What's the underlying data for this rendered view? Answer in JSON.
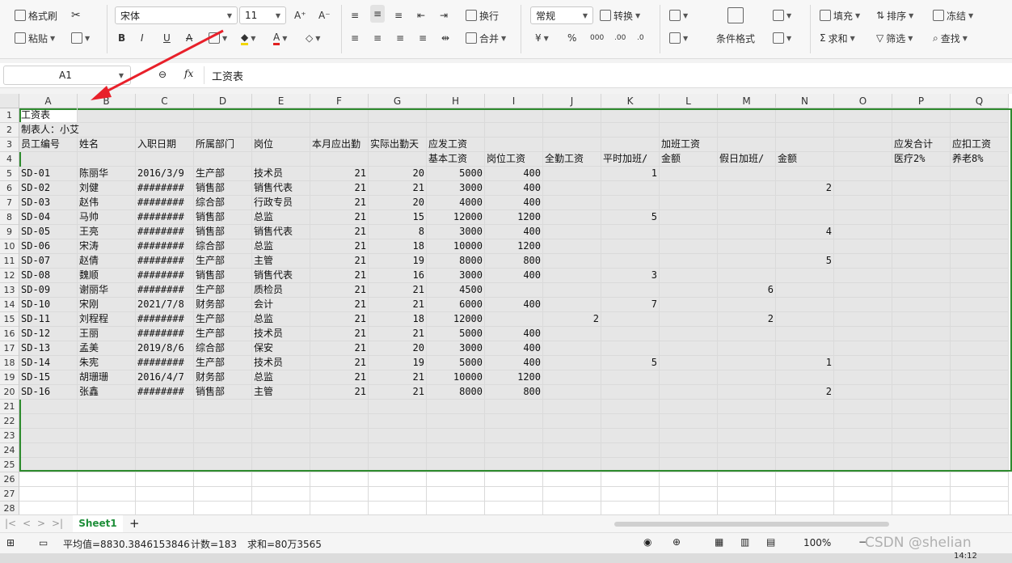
{
  "ribbon": {
    "format_painter": "格式刷",
    "paste": "粘贴",
    "font_name": "宋体",
    "font_size": "11",
    "wrap": "换行",
    "merge": "合并",
    "number_format": "常规",
    "convert": "转换",
    "cond_format": "条件格式",
    "fill": "填充",
    "sort": "排序",
    "freeze": "冻结",
    "sum": "求和",
    "filter": "筛选",
    "find": "查找",
    "bold": "B",
    "italic": "I",
    "underline": "U",
    "font_grow": "A⁺",
    "font_shrink": "A⁻",
    "currency": "¥",
    "percent": "%"
  },
  "formula_bar": {
    "cell_ref": "A1",
    "fx": "fx",
    "content": "工资表"
  },
  "columns": [
    "A",
    "B",
    "C",
    "D",
    "E",
    "F",
    "G",
    "H",
    "I",
    "J",
    "K",
    "L",
    "M",
    "N",
    "O",
    "P",
    "Q"
  ],
  "row_numbers": [
    "1",
    "2",
    "3",
    "4",
    "5",
    "6",
    "7",
    "8",
    "9",
    "10",
    "11",
    "12",
    "13",
    "14",
    "15",
    "16",
    "17",
    "18",
    "19",
    "20",
    "21",
    "22",
    "23",
    "24",
    "25",
    "26",
    "27",
    "28"
  ],
  "rows": [
    [
      "工资表",
      "",
      "",
      "",
      "",
      "",
      "",
      "",
      "",
      "",
      "",
      "",
      "",
      "",
      "",
      "",
      ""
    ],
    [
      "制表人：小艾",
      "",
      "",
      "",
      "",
      "",
      "",
      "",
      "",
      "",
      "",
      "",
      "",
      "",
      "",
      "",
      ""
    ],
    [
      "员工编号",
      "姓名",
      "入职日期",
      "所属部门",
      "岗位",
      "本月应出勤",
      "实际出勤天",
      "应发工资",
      "",
      "",
      "",
      "加班工资",
      "",
      "",
      "",
      "应发合计",
      "应扣工资"
    ],
    [
      "",
      "",
      "",
      "",
      "",
      "",
      "",
      "基本工资",
      "岗位工资",
      "全勤工资",
      "平时加班/",
      "金额",
      "假日加班/",
      "金额",
      "",
      "医疗2%",
      "养老8%"
    ],
    [
      "SD-01",
      "陈丽华",
      "2016/3/9",
      "生产部",
      "技术员",
      "21",
      "20",
      "5000",
      "400",
      "",
      "1",
      "",
      "",
      "",
      "",
      "",
      ""
    ],
    [
      "SD-02",
      "刘健",
      "########",
      "销售部",
      "销售代表",
      "21",
      "21",
      "3000",
      "400",
      "",
      "",
      "",
      "",
      "2",
      "",
      "",
      ""
    ],
    [
      "SD-03",
      "赵伟",
      "########",
      "综合部",
      "行政专员",
      "21",
      "20",
      "4000",
      "400",
      "",
      "",
      "",
      "",
      "",
      "",
      "",
      ""
    ],
    [
      "SD-04",
      "马帅",
      "########",
      "销售部",
      "总监",
      "21",
      "15",
      "12000",
      "1200",
      "",
      "5",
      "",
      "",
      "",
      "",
      "",
      ""
    ],
    [
      "SD-05",
      "王亮",
      "########",
      "销售部",
      "销售代表",
      "21",
      "8",
      "3000",
      "400",
      "",
      "",
      "",
      "",
      "4",
      "",
      "",
      ""
    ],
    [
      "SD-06",
      "宋涛",
      "########",
      "综合部",
      "总监",
      "21",
      "18",
      "10000",
      "1200",
      "",
      "",
      "",
      "",
      "",
      "",
      "",
      ""
    ],
    [
      "SD-07",
      "赵倩",
      "########",
      "生产部",
      "主管",
      "21",
      "19",
      "8000",
      "800",
      "",
      "",
      "",
      "",
      "5",
      "",
      "",
      ""
    ],
    [
      "SD-08",
      "魏顺",
      "########",
      "销售部",
      "销售代表",
      "21",
      "16",
      "3000",
      "400",
      "",
      "3",
      "",
      "",
      "",
      "",
      "",
      ""
    ],
    [
      "SD-09",
      "谢丽华",
      "########",
      "生产部",
      "质检员",
      "21",
      "21",
      "4500",
      "",
      "",
      "",
      "",
      "6",
      "",
      "",
      "",
      ""
    ],
    [
      "SD-10",
      "宋刚",
      "2021/7/8",
      "财务部",
      "会计",
      "21",
      "21",
      "6000",
      "400",
      "",
      "7",
      "",
      "",
      "",
      "",
      "",
      ""
    ],
    [
      "SD-11",
      "刘程程",
      "########",
      "生产部",
      "总监",
      "21",
      "18",
      "12000",
      "",
      "2",
      "",
      "",
      "2",
      "",
      "",
      "",
      ""
    ],
    [
      "SD-12",
      "王丽",
      "########",
      "生产部",
      "技术员",
      "21",
      "21",
      "5000",
      "400",
      "",
      "",
      "",
      "",
      "",
      "",
      "",
      ""
    ],
    [
      "SD-13",
      "孟美",
      "2019/8/6",
      "综合部",
      "保安",
      "21",
      "20",
      "3000",
      "400",
      "",
      "",
      "",
      "",
      "",
      "",
      "",
      ""
    ],
    [
      "SD-14",
      "朱宪",
      "########",
      "生产部",
      "技术员",
      "21",
      "19",
      "5000",
      "400",
      "",
      "5",
      "",
      "",
      "1",
      "",
      "",
      ""
    ],
    [
      "SD-15",
      "胡珊珊",
      "2016/4/7",
      "财务部",
      "总监",
      "21",
      "21",
      "10000",
      "1200",
      "",
      "",
      "",
      "",
      "",
      "",
      "",
      ""
    ],
    [
      "SD-16",
      "张鑫",
      "########",
      "销售部",
      "主管",
      "21",
      "21",
      "8000",
      "800",
      "",
      "",
      "",
      "",
      "2",
      "",
      "",
      ""
    ]
  ],
  "sheet_tabs": [
    "Sheet1"
  ],
  "status": {
    "average": "平均值=8830.3846153846",
    "count": "计数=183",
    "sum": "求和=80万3565",
    "zoom": "100%",
    "watermark": "CSDN @shelian",
    "time": "14:12"
  }
}
